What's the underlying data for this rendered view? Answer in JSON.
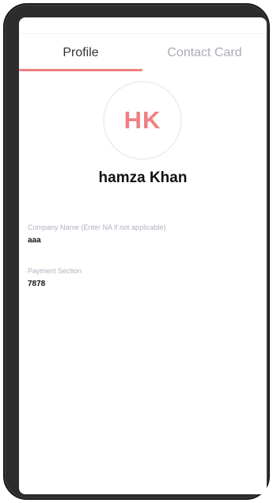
{
  "tabs": {
    "profile": "Profile",
    "contact_card": "Contact Card"
  },
  "profile": {
    "initials": "HK",
    "name": "hamza Khan",
    "company_label": "Company Name (Enter NA if not applicable)",
    "company_value": "aaa",
    "payment_label": "Payment Section",
    "payment_value": "7878"
  },
  "colors": {
    "accent": "#f07f82",
    "inactive_tab": "#a9adb4",
    "label": "#adb3bd",
    "text": "#111111"
  }
}
